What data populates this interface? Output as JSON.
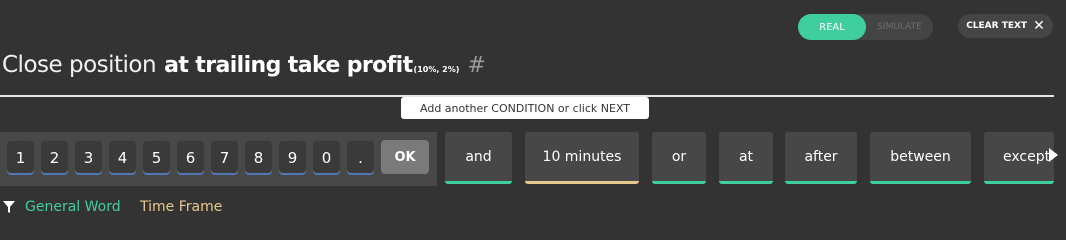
{
  "mode": {
    "real": "REAL",
    "simulate": "SIMULATE"
  },
  "clear": {
    "label": "CLEAR TEXT",
    "icon": "✕"
  },
  "sentence": {
    "prefix": "Close position",
    "main": "at trailing take profit",
    "params": "(10%, 2%)",
    "hash": "#"
  },
  "hint": "Add another CONDITION or click NEXT",
  "keypad": {
    "keys": [
      "1",
      "2",
      "3",
      "4",
      "5",
      "6",
      "7",
      "8",
      "9",
      "0",
      "."
    ],
    "ok": "OK"
  },
  "chips": [
    {
      "label": "and",
      "category": "general"
    },
    {
      "label": "10 minutes",
      "category": "time"
    },
    {
      "label": "or",
      "category": "general"
    },
    {
      "label": "at",
      "category": "general"
    },
    {
      "label": "after",
      "category": "general"
    },
    {
      "label": "between",
      "category": "general"
    },
    {
      "label": "except",
      "category": "general"
    }
  ],
  "legend": {
    "general": "General Word",
    "time": "Time Frame"
  },
  "colors": {
    "accent": "#3fcf9f",
    "time": "#e8c88f",
    "background": "#333333"
  }
}
